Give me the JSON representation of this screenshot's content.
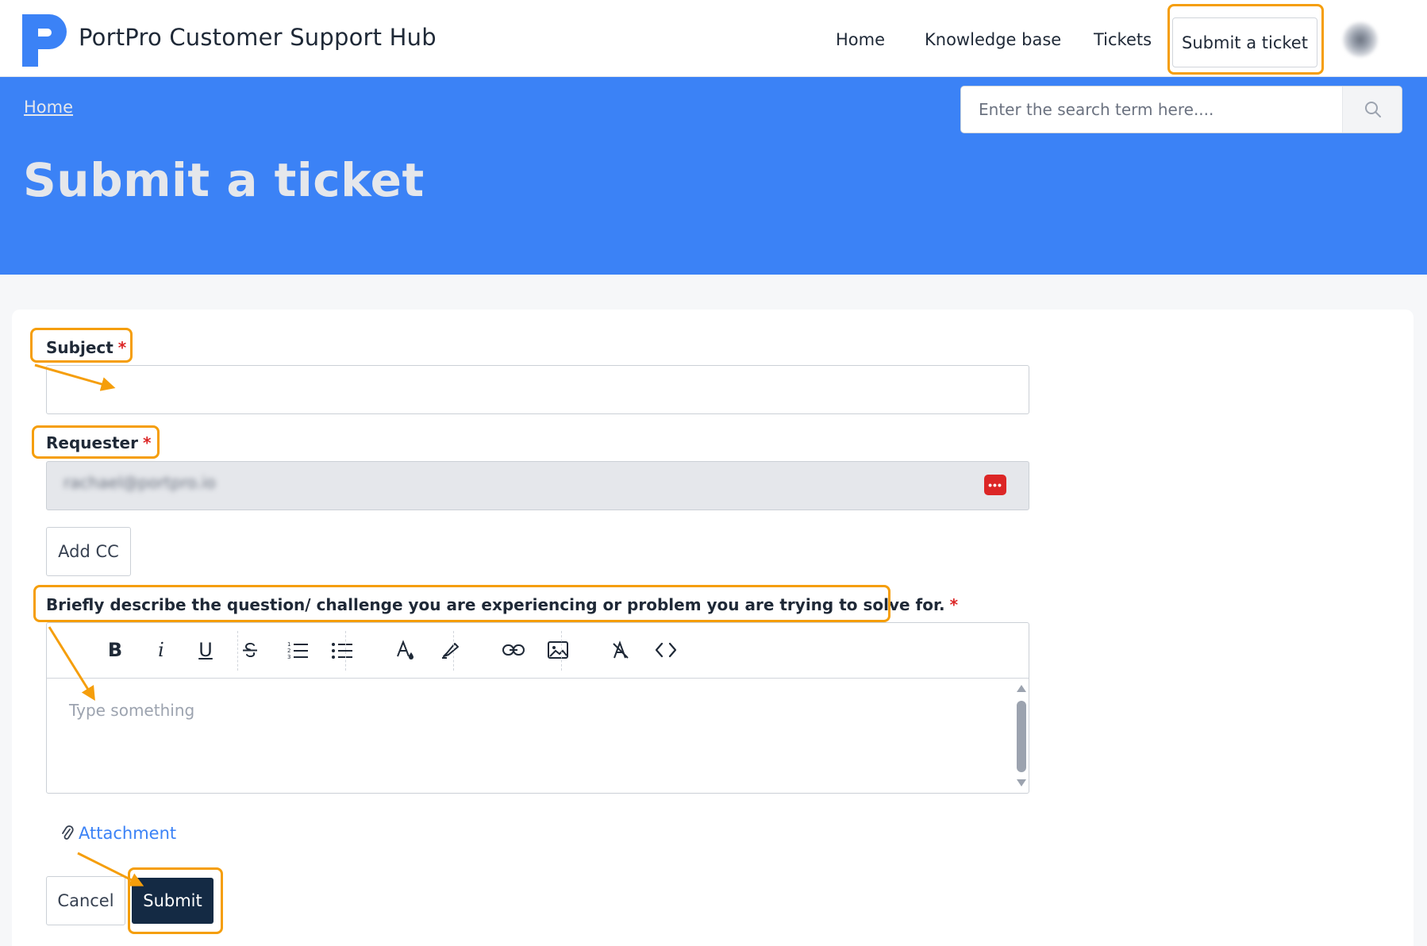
{
  "header": {
    "brand": "PortPro Customer Support Hub",
    "nav": {
      "home": "Home",
      "knowledge_base": "Knowledge base",
      "tickets": "Tickets",
      "submit_ticket": "Submit a ticket"
    }
  },
  "hero": {
    "breadcrumb": "Home",
    "title": "Submit a ticket",
    "search_placeholder": "Enter the search term here...."
  },
  "form": {
    "subject": {
      "label": "Subject",
      "required_mark": "*",
      "value": ""
    },
    "requester": {
      "label": "Requester",
      "required_mark": "*",
      "value": "rachael@portpro.io",
      "badge": "•••"
    },
    "add_cc": "Add CC",
    "description": {
      "label": "Briefly describe the question/ challenge you are experiencing or problem you are trying to solve for.",
      "required_mark": "*",
      "placeholder": "Type something"
    },
    "attachment": "Attachment",
    "cancel": "Cancel",
    "submit": "Submit"
  },
  "toolbar": {
    "bold": "B",
    "italic": "i",
    "underline": "U"
  },
  "colors": {
    "brand_blue": "#3b82f6",
    "highlight_orange": "#f59e0b",
    "submit_navy": "#142a44",
    "required_red": "#dc2626"
  }
}
